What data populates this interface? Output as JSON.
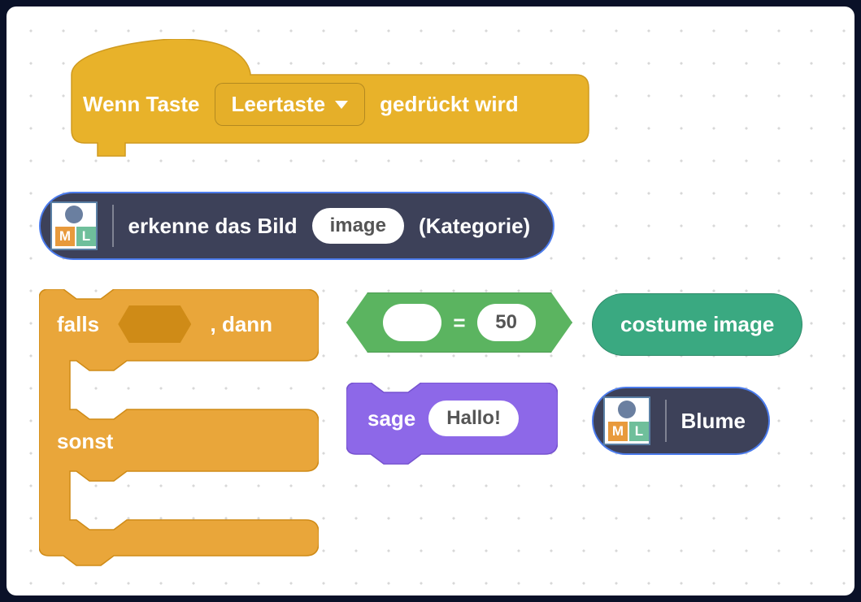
{
  "hat": {
    "prefix": "Wenn Taste",
    "dropdown": "Leertaste",
    "suffix": "gedrückt wird"
  },
  "recognize": {
    "prefix": "erkenne das Bild",
    "param": "image",
    "suffix": "(Kategorie)"
  },
  "ifelse": {
    "if_prefix": "falls",
    "if_suffix": ", dann",
    "else": "sonst"
  },
  "operator": {
    "left": "",
    "op": "=",
    "right": "50"
  },
  "costume": {
    "label": "costume image"
  },
  "say": {
    "label": "sage",
    "value": "Hallo!"
  },
  "blume": {
    "label": "Blume"
  },
  "ml_icon": {
    "letter_m": "M",
    "letter_l": "L"
  }
}
